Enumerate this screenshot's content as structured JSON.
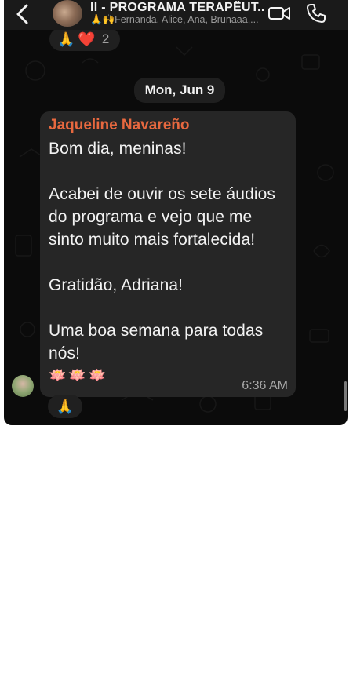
{
  "header": {
    "title": "II - PROGRAMA  TERAPÊUT...",
    "subtitle": "🙏🙌Fernanda, Alice, Ana, Brunaaa,..."
  },
  "top_reactions": {
    "emojis": [
      "🙏",
      "❤️"
    ],
    "count": "2"
  },
  "date_separator": "Mon, Jun 9",
  "message": {
    "sender": "Jaqueline Navareño",
    "text": "Bom dia, meninas!\n\nAcabei de ouvir os sete áudios do programa e vejo que me sinto muito mais fortalecida!\n\nGratidão, Adriana!\n\nUma boa semana para todas nós!",
    "emoji_line": "🪷🪷🪷",
    "time": "6:36 AM"
  },
  "bottom_reaction": "🙏",
  "colors": {
    "sender_name": "#e7683f",
    "bubble": "#262626",
    "background": "#0b0b0b"
  }
}
